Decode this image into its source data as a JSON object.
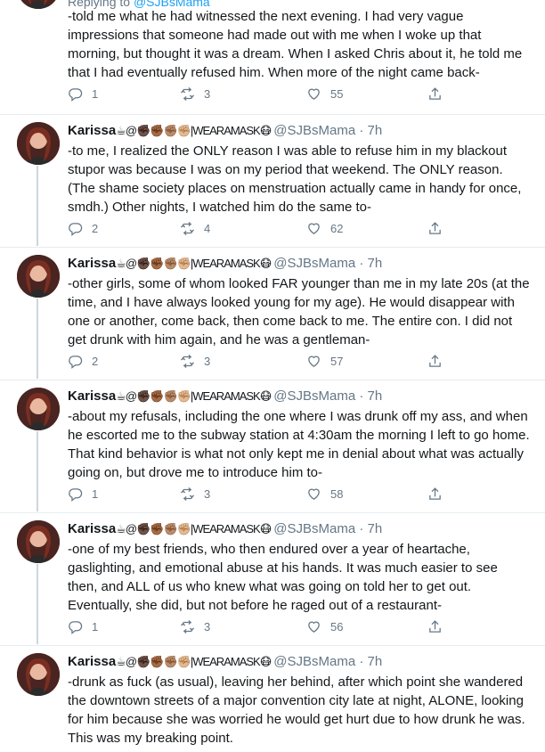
{
  "replying_to": {
    "label": "Replying to",
    "handle": "@SJBsMama"
  },
  "tweets": [
    {
      "name": "",
      "emojis": "",
      "handle": "",
      "time": "",
      "text": "-told me what he had witnessed the next evening. I had very vague impressions that someone had made out with me when I woke up that morning, but thought it was a dream. When I asked Chris about it, he told me that I had eventually refused him. When more of the night came back-",
      "replies": "1",
      "retweets": "3",
      "likes": "55"
    },
    {
      "name": "Karissa",
      "emojis": "☕@✊🏿✊🏾✊🏽✊🏼|WEARAMASK😷",
      "handle": "@SJBsMama · 7h",
      "text": "-to me, I realized the ONLY reason I was able to refuse him in my blackout stupor was because I was on my period that weekend. The ONLY reason. (The shame society places on menstruation actually came in handy for once, smdh.) Other nights, I watched him do the same to-",
      "replies": "2",
      "retweets": "4",
      "likes": "62"
    },
    {
      "name": "Karissa",
      "emojis": "☕@✊🏿✊🏾✊🏽✊🏼|WEARAMASK😷",
      "handle": "@SJBsMama · 7h",
      "text": "-other girls, some of whom looked FAR younger than me in my late 20s (at the time, and I have always looked young for my age). He would disappear with one or another, come back, then come back to me. The entire con. I did not get drunk with him again, and he was a gentleman-",
      "replies": "2",
      "retweets": "3",
      "likes": "57"
    },
    {
      "name": "Karissa",
      "emojis": "☕@✊🏿✊🏾✊🏽✊🏼|WEARAMASK😷",
      "handle": "@SJBsMama · 7h",
      "text": "-about my refusals, including the one where I was drunk off my ass, and when he escorted me to the subway station at 4:30am the morning I left to go home. That kind behavior is what not only kept me in denial about what was actually going on, but drove me to introduce him to-",
      "replies": "1",
      "retweets": "3",
      "likes": "58"
    },
    {
      "name": "Karissa",
      "emojis": "☕@✊🏿✊🏾✊🏽✊🏼|WEARAMASK😷",
      "handle": "@SJBsMama · 7h",
      "text": "-one of my best friends, who then endured over a year of heartache, gaslighting, and emotional abuse at his hands. It was much easier to see then, and ALL of us who knew what was going on told her to get out. Eventually, she did, but not before he raged out of a restaurant-",
      "replies": "1",
      "retweets": "3",
      "likes": "56"
    },
    {
      "name": "Karissa",
      "emojis": "☕@✊🏿✊🏾✊🏽✊🏼|WEARAMASK😷",
      "handle": "@SJBsMama · 7h",
      "text": "-drunk as fuck (as usual), leaving her behind, after which point she wandered the downtown streets of a major convention city late at night, ALONE, looking for him because she was worried he would get hurt due to how drunk he was. This was my breaking point.",
      "replies": "",
      "retweets": "",
      "likes": ""
    }
  ]
}
